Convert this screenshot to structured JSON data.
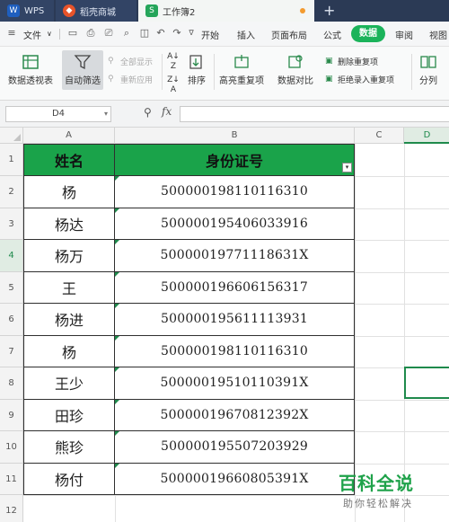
{
  "tabs": [
    {
      "label": "WPS",
      "icon": "wps-logo-icon"
    },
    {
      "label": "稻壳商城",
      "icon": "docer-store-icon"
    },
    {
      "label": "工作簿2",
      "icon": "spreadsheet-icon"
    }
  ],
  "menu": {
    "file": "文件",
    "items": [
      "开始",
      "插入",
      "页面布局",
      "公式",
      "数据",
      "审阅",
      "视图"
    ],
    "active": "数据"
  },
  "ribbon": {
    "pivot": "数据透视表",
    "auto_filter": "自动筛选",
    "show_all": "全部显示",
    "reapply": "重新应用",
    "sort": "排序",
    "highlight_dup": "高亮重复项",
    "compare": "数据对比",
    "delete_dup": "删除重复项",
    "reject_dup": "拒绝录入重复项",
    "split": "分列"
  },
  "formula_bar": {
    "name_box": "D4",
    "fx": "fx",
    "value": ""
  },
  "columns": [
    "A",
    "B",
    "C",
    "D"
  ],
  "selected_column": "D",
  "selected_row": "4",
  "header_row": {
    "name": "姓名",
    "id": "身份证号"
  },
  "rows": [
    {
      "num": "2",
      "name": "杨",
      "id": "500000198110116310"
    },
    {
      "num": "3",
      "name": "杨达",
      "id": "500000195406033916"
    },
    {
      "num": "4",
      "name": "杨万",
      "id": "50000019771118631X"
    },
    {
      "num": "5",
      "name": "王",
      "id": "500000196606156317"
    },
    {
      "num": "6",
      "name": "杨进",
      "id": "500000195611113931"
    },
    {
      "num": "7",
      "name": "杨",
      "id": "500000198110116310"
    },
    {
      "num": "8",
      "name": "王少",
      "id": "50000019510110391X"
    },
    {
      "num": "9",
      "name": "田珍",
      "id": "50000019670812392X"
    },
    {
      "num": "10",
      "name": "熊珍",
      "id": "500000195507203929"
    },
    {
      "num": "11",
      "name": "杨付",
      "id": "50000019660805391X"
    },
    {
      "num": "12",
      "name": "",
      "id": ""
    }
  ],
  "row_numbers_header": "1",
  "watermark": {
    "title": "百科全说",
    "subtitle": "助你轻松解决"
  },
  "colors": {
    "accent": "#1aa34a",
    "selection": "#1f8a4c",
    "tabbar": "#2b3a55"
  }
}
